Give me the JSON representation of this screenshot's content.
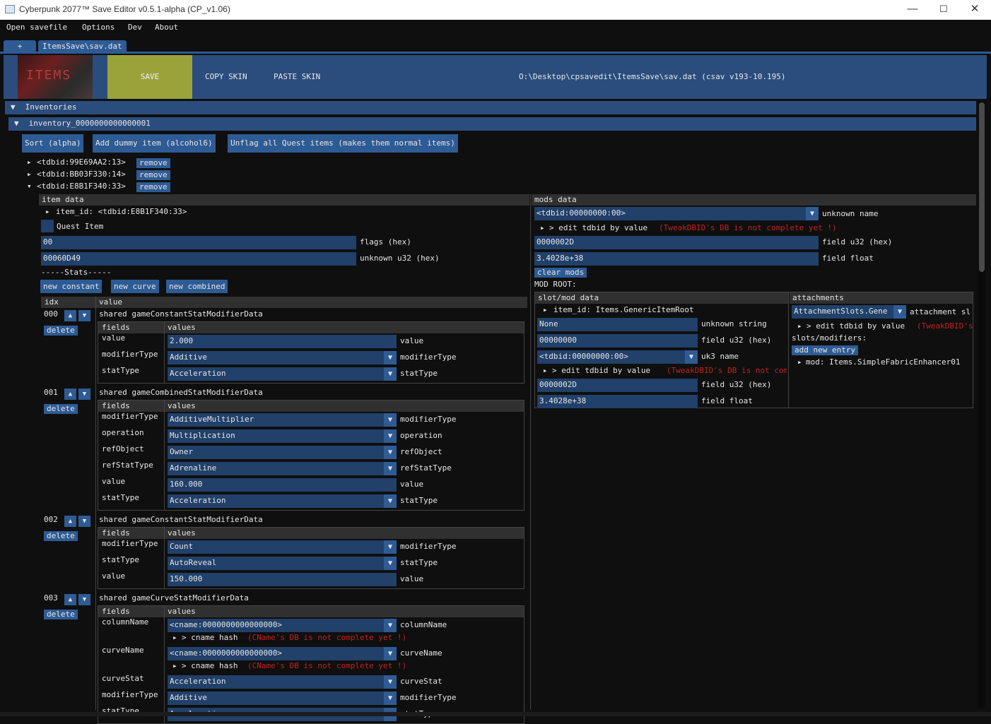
{
  "window": {
    "title": "Cyberpunk 2077™ Save Editor v0.5.1-alpha (CP_v1.06)",
    "min": "—",
    "max": "☐",
    "close": "✕"
  },
  "menu": [
    "Open savefile",
    "Options",
    "Dev",
    "About"
  ],
  "tabs": {
    "add": "+",
    "file": "ItemsSave\\sav.dat"
  },
  "toolbar": {
    "thumb_text": "ITEMS",
    "save": "SAVE",
    "copy_skin": "COPY SKIN",
    "paste_skin": "PASTE SKIN",
    "path": "O:\\Desktop\\cpsavedit\\ItemsSave\\sav.dat (csav v193-10.195)"
  },
  "inventories": {
    "header": "Inventories",
    "inventory_name": "inventory_0000000000000001"
  },
  "actions": {
    "sort": "Sort (alpha)",
    "add_dummy": "Add dummy item (alcohol6)",
    "unflag": "Unflag all Quest items (makes them normal items)"
  },
  "items": [
    {
      "id": "<tdbid:99E69AA2:13>",
      "remove": "remove"
    },
    {
      "id": "<tdbid:BB03F330:14>",
      "remove": "remove"
    },
    {
      "id": "<tdbid:E8B1F340:33>",
      "remove": "remove"
    }
  ],
  "item_data": {
    "header": "item data",
    "item_id": "item_id: <tdbid:E8B1F340:33>",
    "quest_item": "Quest Item",
    "flags_value": "00",
    "flags_label": "flags (hex)",
    "u32_value": "00060D49",
    "u32_label": "unknown u32 (hex)",
    "stats_label": "-----Stats-----",
    "new_constant": "new constant",
    "new_curve": "new curve",
    "new_combined": "new combined",
    "col_idx": "idx",
    "col_value": "value",
    "fields_label": "fields",
    "values_label": "values",
    "delete": "delete",
    "up": "▲",
    "down": "▼"
  },
  "stats": [
    {
      "idx": "000",
      "type": "shared gameConstantStatModifierData",
      "rows": [
        {
          "field": "value",
          "value": "2.000",
          "label": "value",
          "combo": false
        },
        {
          "field": "modifierType",
          "value": "Additive",
          "label": "modifierType",
          "combo": true
        },
        {
          "field": "statType",
          "value": "Acceleration",
          "label": "statType",
          "combo": true
        }
      ]
    },
    {
      "idx": "001",
      "type": "shared gameCombinedStatModifierData",
      "rows": [
        {
          "field": "modifierType",
          "value": "AdditiveMultiplier",
          "label": "modifierType",
          "combo": true
        },
        {
          "field": "operation",
          "value": "Multiplication",
          "label": "operation",
          "combo": true
        },
        {
          "field": "refObject",
          "value": "Owner",
          "label": "refObject",
          "combo": true
        },
        {
          "field": "refStatType",
          "value": "Adrenaline",
          "label": "refStatType",
          "combo": true
        },
        {
          "field": "value",
          "value": "160.000",
          "label": "value",
          "combo": false
        },
        {
          "field": "statType",
          "value": "Acceleration",
          "label": "statType",
          "combo": true
        }
      ]
    },
    {
      "idx": "002",
      "type": "shared gameConstantStatModifierData",
      "rows": [
        {
          "field": "modifierType",
          "value": "Count",
          "label": "modifierType",
          "combo": true
        },
        {
          "field": "statType",
          "value": "AutoReveal",
          "label": "statType",
          "combo": true
        },
        {
          "field": "value",
          "value": "150.000",
          "label": "value",
          "combo": false
        }
      ]
    },
    {
      "idx": "003",
      "type": "shared gameCurveStatModifierData",
      "rows": [
        {
          "field": "columnName",
          "value": "<cname:0000000000000000>",
          "label": "columnName",
          "combo": true,
          "sub": "> cname hash",
          "subnote": "(CName's DB is not complete yet !)"
        },
        {
          "field": "curveName",
          "value": "<cname:0000000000000000>",
          "label": "curveName",
          "combo": true,
          "sub": "> cname hash",
          "subnote": "(CName's DB is not complete yet !)"
        },
        {
          "field": "curveStat",
          "value": "Acceleration",
          "label": "curveStat",
          "combo": true
        },
        {
          "field": "modifierType",
          "value": "Additive",
          "label": "modifierType",
          "combo": true
        },
        {
          "field": "statType",
          "value": "Acceleration",
          "label": "statType",
          "combo": true
        }
      ]
    }
  ],
  "mods": {
    "header": "mods data",
    "tdbid": "<tdbid:00000000:00>",
    "unknown_name": "unknown name",
    "edit_tdbid": "> edit tdbid by value",
    "edit_note": "(TweakDBID's DB is not complete yet !)",
    "u32_value": "0000002D",
    "u32_label": "field u32 (hex)",
    "float_value": "3.4028e+38",
    "float_label": "field float",
    "clear_mods": "clear mods",
    "mod_root": "MOD ROOT:",
    "slot_header": "slot/mod data",
    "attach_header": "attachments",
    "slot_item_id": "item_id: Items.GenericItemRoot",
    "slot_unknown_value": "None",
    "slot_unknown_label": "unknown string",
    "slot_hex_value": "00000000",
    "slot_hex_label": "field u32 (hex)",
    "slot_tdbid": "<tdbid:00000000:00>",
    "slot_uk3": "uk3 name",
    "slot_edit": "> edit tdbid by value",
    "slot_edit_note": "(TweakDBID's DB is not complete yet !)",
    "slot_u32_value": "0000002D",
    "slot_u32_label": "field u32 (hex)",
    "slot_float_value": "3.4028e+38",
    "slot_float_label": "field float",
    "attach_combo": "AttachmentSlots.Gene",
    "attach_label": "attachment sl",
    "attach_edit": "> edit tdbid by value",
    "attach_edit_note": "(TweakDBID's",
    "slots_modifiers": "slots/modifiers:",
    "add_new_entry": "add new entry",
    "mod_entry": "mod: Items.SimpleFabricEnhancer01"
  }
}
